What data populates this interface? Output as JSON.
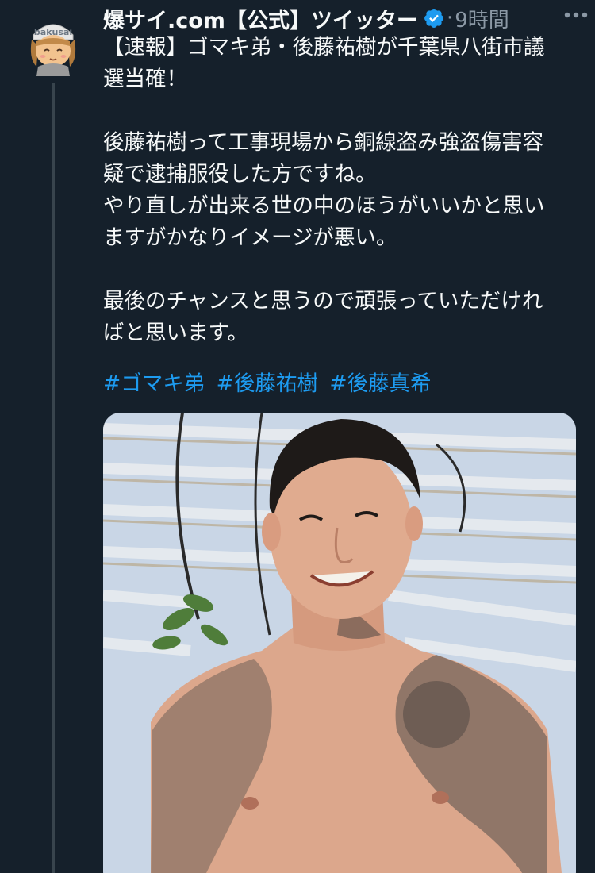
{
  "tweet": {
    "author": {
      "display_name": "爆サイ.com【公式】ツイッター",
      "avatar_text": "bakusai"
    },
    "timestamp": "9時間",
    "separator": "·",
    "body_lines": [
      "【速報】ゴマキ弟・後藤祐樹が千葉県八街市議",
      "選当確！",
      "",
      "後藤祐樹って工事現場から銅線盗み強盗傷害容",
      "疑で逮捕服役した方ですね。",
      "やり直しが出来る世の中のほうがいいかと思い",
      "ますがかなりイメージが悪い。",
      "",
      "最後のチャンスと思うので頑張っていただけれ",
      "ばと思います。"
    ],
    "hashtags": [
      "#ゴマキ弟",
      "#後藤祐樹",
      "#後藤真希"
    ],
    "icons": {
      "verified": "verified-badge-icon",
      "more": "more-options-icon"
    },
    "colors": {
      "background": "#15202b",
      "text": "#f7f9f9",
      "secondary": "#8b98a5",
      "accent": "#1d9bf0"
    }
  }
}
